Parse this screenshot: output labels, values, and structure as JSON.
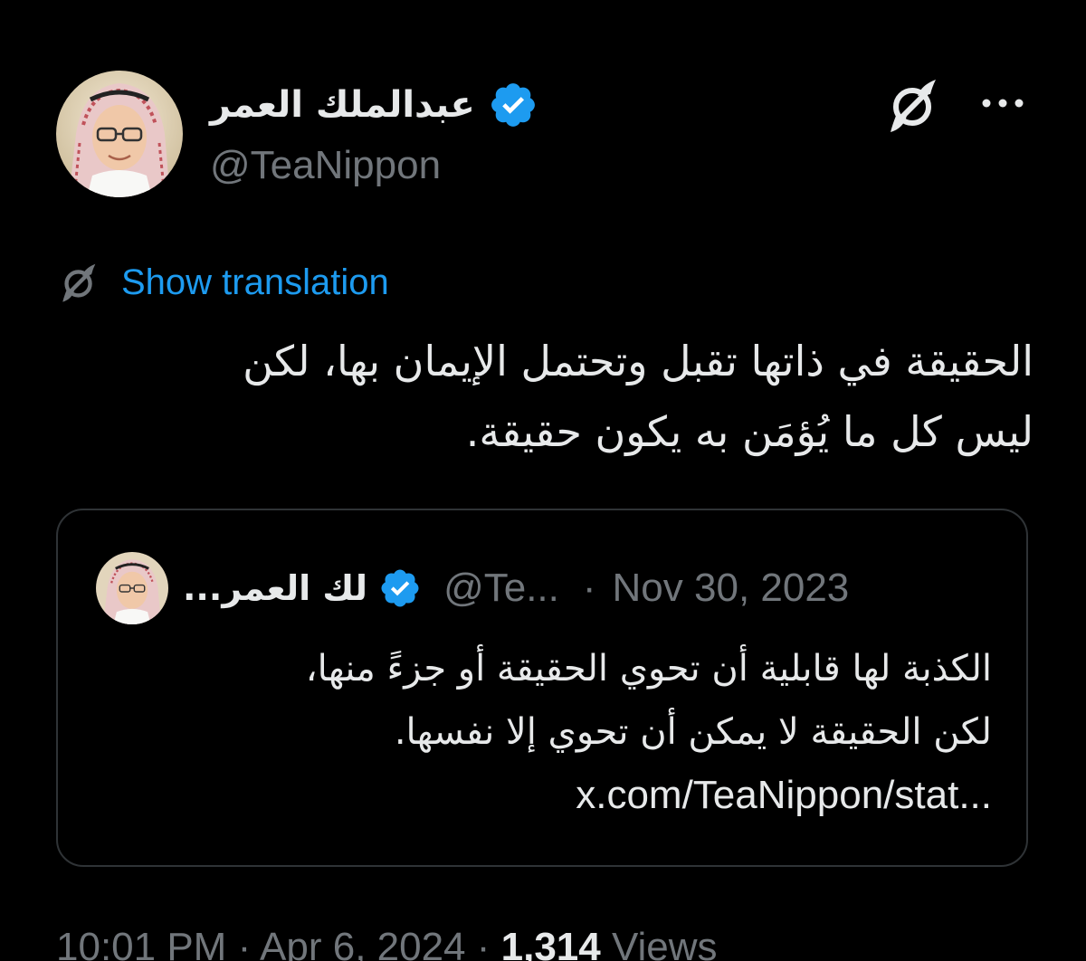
{
  "author": {
    "display_name": "عبدالملك العمر",
    "handle": "@TeaNippon",
    "verified": true,
    "avatar_icon": "profile-photo"
  },
  "actions": {
    "translate_icon": "translate-icon",
    "more_icon": "more-horizontal-icon"
  },
  "translation": {
    "label": "Show translation",
    "icon": "translate-icon"
  },
  "tweet": {
    "text_line1": "الحقيقة في ذاتها تقبل وتحتمل الإيمان بها، لكن",
    "text_line2": "ليس كل ما يُؤمَن به يكون حقيقة."
  },
  "quote": {
    "display_name": "...لك العمر",
    "handle": "@Te...",
    "separator": "·",
    "date": "Nov 30, 2023",
    "text_line1": "الكذبة لها قابلية أن تحوي الحقيقة أو جزءً منها،",
    "text_line2": "لكن الحقيقة لا يمكن أن تحوي إلا نفسها.",
    "link": "x.com/TeaNippon/stat..."
  },
  "meta": {
    "time": "10:01 PM",
    "sep1": " · ",
    "date": "Apr 6, 2024",
    "sep2": " · ",
    "views_count": "1,314",
    "views_label": " Views"
  },
  "colors": {
    "background": "#000000",
    "text": "#e7e9ea",
    "secondary": "#71767b",
    "accent": "#1d9bf0",
    "border": "#2f3336"
  }
}
